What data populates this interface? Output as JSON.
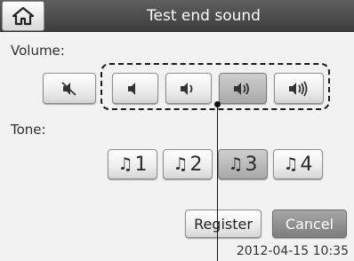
{
  "header": {
    "title": "Test end sound",
    "home_icon": "home-icon"
  },
  "volume": {
    "label": "Volume:",
    "levels": [
      {
        "icon": "speaker-mute-icon"
      },
      {
        "icon": "speaker-level-1-icon"
      },
      {
        "icon": "speaker-level-2-icon"
      },
      {
        "icon": "speaker-level-3-icon",
        "selected": true
      },
      {
        "icon": "speaker-level-4-icon"
      }
    ]
  },
  "tone": {
    "label": "Tone:",
    "options": [
      {
        "number": "1"
      },
      {
        "number": "2"
      },
      {
        "number": "3",
        "selected": true
      },
      {
        "number": "4"
      }
    ],
    "note_glyph": "♫"
  },
  "buttons": {
    "register": "Register",
    "cancel": "Cancel"
  },
  "status": {
    "datetime": "2012-04-15 10:35"
  },
  "colors": {
    "title_bar": "#4a4a4a",
    "selected": "#b5b5b5",
    "cancel_bg": "#8e8e8e"
  }
}
